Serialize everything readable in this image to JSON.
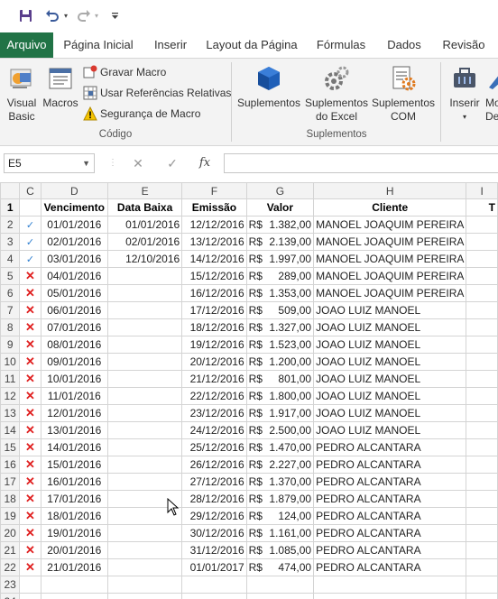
{
  "qat": {
    "save_icon": "save-icon",
    "undo_icon": "undo-icon",
    "redo_icon": "redo-icon",
    "customize_icon": "customize-qat-icon"
  },
  "tabs": [
    {
      "label": "Arquivo"
    },
    {
      "label": "Página Inicial"
    },
    {
      "label": "Inserir"
    },
    {
      "label": "Layout da Página"
    },
    {
      "label": "Fórmulas"
    },
    {
      "label": "Dados"
    },
    {
      "label": "Revisão"
    }
  ],
  "ribbon": {
    "visual_basic_line1": "Visual",
    "visual_basic_line2": "Basic",
    "macros": "Macros",
    "record_macro": "Gravar Macro",
    "relative_refs": "Usar Referências Relativas",
    "macro_security": "Segurança de Macro",
    "group_code": "Código",
    "addins": "Suplementos",
    "excel_addins_line1": "Suplementos",
    "excel_addins_line2": "do Excel",
    "com_addins_line1": "Suplementos",
    "com_addins_line2": "COM",
    "group_addins": "Suplementos",
    "insert": "Inserir",
    "partial_next": "Mo",
    "partial_next2": "De"
  },
  "formula_bar": {
    "name_box": "E5",
    "cancel": "✕",
    "enter": "✓",
    "fx": "fx",
    "formula": ""
  },
  "colors": {
    "file_tab": "#217346",
    "x_mark": "#e02020",
    "check_mark": "#2f7fd0"
  },
  "sheet": {
    "columns": [
      "C",
      "D",
      "E",
      "F",
      "G",
      "H",
      "I"
    ],
    "header_row": {
      "row": "1",
      "c": "",
      "vencimento": "Vencimento",
      "data_baixa": "Data Baixa",
      "emissao": "Emissão",
      "valor": "Valor",
      "cliente": "Cliente",
      "extra": "T"
    },
    "currency": "R$",
    "rows": [
      {
        "n": "2",
        "mark": "✓",
        "venc": "01/01/2016",
        "baixa": "01/01/2016",
        "emissao": "12/12/2016",
        "valor": "1.382,00",
        "cliente": "MANOEL JOAQUIM PEREIRA"
      },
      {
        "n": "3",
        "mark": "✓",
        "venc": "02/01/2016",
        "baixa": "02/01/2016",
        "emissao": "13/12/2016",
        "valor": "2.139,00",
        "cliente": "MANOEL JOAQUIM PEREIRA"
      },
      {
        "n": "4",
        "mark": "✓",
        "venc": "03/01/2016",
        "baixa": "12/10/2016",
        "emissao": "14/12/2016",
        "valor": "1.997,00",
        "cliente": "MANOEL JOAQUIM PEREIRA"
      },
      {
        "n": "5",
        "mark": "✕",
        "venc": "04/01/2016",
        "baixa": "",
        "emissao": "15/12/2016",
        "valor": "289,00",
        "cliente": "MANOEL JOAQUIM PEREIRA"
      },
      {
        "n": "6",
        "mark": "✕",
        "venc": "05/01/2016",
        "baixa": "",
        "emissao": "16/12/2016",
        "valor": "1.353,00",
        "cliente": "MANOEL JOAQUIM PEREIRA"
      },
      {
        "n": "7",
        "mark": "✕",
        "venc": "06/01/2016",
        "baixa": "",
        "emissao": "17/12/2016",
        "valor": "509,00",
        "cliente": "JOAO LUIZ MANOEL"
      },
      {
        "n": "8",
        "mark": "✕",
        "venc": "07/01/2016",
        "baixa": "",
        "emissao": "18/12/2016",
        "valor": "1.327,00",
        "cliente": "JOAO LUIZ MANOEL"
      },
      {
        "n": "9",
        "mark": "✕",
        "venc": "08/01/2016",
        "baixa": "",
        "emissao": "19/12/2016",
        "valor": "1.523,00",
        "cliente": "JOAO LUIZ MANOEL"
      },
      {
        "n": "10",
        "mark": "✕",
        "venc": "09/01/2016",
        "baixa": "",
        "emissao": "20/12/2016",
        "valor": "1.200,00",
        "cliente": "JOAO LUIZ MANOEL"
      },
      {
        "n": "11",
        "mark": "✕",
        "venc": "10/01/2016",
        "baixa": "",
        "emissao": "21/12/2016",
        "valor": "801,00",
        "cliente": "JOAO LUIZ MANOEL"
      },
      {
        "n": "12",
        "mark": "✕",
        "venc": "11/01/2016",
        "baixa": "",
        "emissao": "22/12/2016",
        "valor": "1.800,00",
        "cliente": "JOAO LUIZ MANOEL"
      },
      {
        "n": "13",
        "mark": "✕",
        "venc": "12/01/2016",
        "baixa": "",
        "emissao": "23/12/2016",
        "valor": "1.917,00",
        "cliente": "JOAO LUIZ MANOEL"
      },
      {
        "n": "14",
        "mark": "✕",
        "venc": "13/01/2016",
        "baixa": "",
        "emissao": "24/12/2016",
        "valor": "2.500,00",
        "cliente": "JOAO LUIZ MANOEL"
      },
      {
        "n": "15",
        "mark": "✕",
        "venc": "14/01/2016",
        "baixa": "",
        "emissao": "25/12/2016",
        "valor": "1.470,00",
        "cliente": "PEDRO ALCANTARA"
      },
      {
        "n": "16",
        "mark": "✕",
        "venc": "15/01/2016",
        "baixa": "",
        "emissao": "26/12/2016",
        "valor": "2.227,00",
        "cliente": "PEDRO ALCANTARA"
      },
      {
        "n": "17",
        "mark": "✕",
        "venc": "16/01/2016",
        "baixa": "",
        "emissao": "27/12/2016",
        "valor": "1.370,00",
        "cliente": "PEDRO ALCANTARA"
      },
      {
        "n": "18",
        "mark": "✕",
        "venc": "17/01/2016",
        "baixa": "",
        "emissao": "28/12/2016",
        "valor": "1.879,00",
        "cliente": "PEDRO ALCANTARA"
      },
      {
        "n": "19",
        "mark": "✕",
        "venc": "18/01/2016",
        "baixa": "",
        "emissao": "29/12/2016",
        "valor": "124,00",
        "cliente": "PEDRO ALCANTARA"
      },
      {
        "n": "20",
        "mark": "✕",
        "venc": "19/01/2016",
        "baixa": "",
        "emissao": "30/12/2016",
        "valor": "1.161,00",
        "cliente": "PEDRO ALCANTARA"
      },
      {
        "n": "21",
        "mark": "✕",
        "venc": "20/01/2016",
        "baixa": "",
        "emissao": "31/12/2016",
        "valor": "1.085,00",
        "cliente": "PEDRO ALCANTARA"
      },
      {
        "n": "22",
        "mark": "✕",
        "venc": "21/01/2016",
        "baixa": "",
        "emissao": "01/01/2017",
        "valor": "474,00",
        "cliente": "PEDRO ALCANTARA"
      }
    ],
    "empty_rows": [
      "23",
      "24"
    ]
  }
}
